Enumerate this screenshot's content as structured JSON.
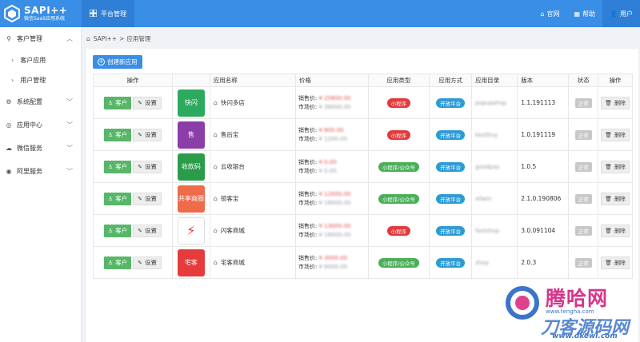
{
  "logo": {
    "title": "SAPI++",
    "subtitle": "微信SaaS应用系统"
  },
  "topbar": {
    "tab": "平台管理",
    "links": [
      "官网",
      "帮助",
      "用户"
    ]
  },
  "sidebar": {
    "items": [
      {
        "label": "客户管理",
        "children": [
          "客户应用",
          "用户管理"
        ]
      },
      {
        "label": "系统配置"
      },
      {
        "label": "应用中心"
      },
      {
        "label": "微信服务"
      },
      {
        "label": "阿里服务"
      }
    ]
  },
  "breadcrumb": {
    "root": "SAPI++",
    "sep": ">",
    "current": "应用管理"
  },
  "create_button": "创建新应用",
  "table": {
    "headers": [
      "操作",
      "",
      "应用名称",
      "价格",
      "应用类型",
      "应用方式",
      "应用目录",
      "版本",
      "状态",
      "操作"
    ],
    "btn_customer": "客户",
    "btn_settings": "设置",
    "btn_delete": "删除",
    "price_sale_label": "销售价:",
    "price_market_label": "市场价:",
    "rows": [
      {
        "name": "快闪多店",
        "icon": "快闪",
        "icon_color": "#2eaa60",
        "sale": "¥ 25800.00",
        "market": "¥ 38000.00",
        "type": "小程序",
        "type_style": "red",
        "mode": "开放平台",
        "dir": "popupshop",
        "version": "1.1.191113",
        "status": "正常"
      },
      {
        "name": "售后宝",
        "icon": "售",
        "icon_color": "#8b3da8",
        "sale": "¥ 800.00",
        "market": "¥ 1200.00",
        "type": "小程序",
        "type_style": "red",
        "mode": "开放平台",
        "dir": "bestbuy",
        "version": "1.0.191119",
        "status": "正常"
      },
      {
        "name": "云收银台",
        "icon": "收款码",
        "icon_color": "#2a9c4a",
        "sale": "¥ 0.00",
        "market": "¥ 0.00",
        "type": "小程序/公众号",
        "type_style": "green",
        "mode": "开放平台",
        "dir": "goodpay",
        "version": "1.0.5",
        "status": "正常"
      },
      {
        "name": "锁客宝",
        "icon": "共享商圈",
        "icon_color": "#ee6c4a",
        "sale": "¥ 12000.00",
        "market": "¥ 18000.00",
        "type": "小程序/公众号",
        "type_style": "green",
        "mode": "开放平台",
        "dir": "allwin",
        "version": "2.1.0.190806",
        "status": "正常"
      },
      {
        "name": "闪客商城",
        "icon": "⚡",
        "icon_color": "#ffffff",
        "sale": "¥ 13000.00",
        "market": "¥ 18000.00",
        "type": "小程序",
        "type_style": "red",
        "mode": "开放平台",
        "dir": "fastshop",
        "version": "3.0.091104",
        "status": "正常"
      },
      {
        "name": "宅客商城",
        "icon": "宅客",
        "icon_color": "#e53b3b",
        "sale": "¥ 3000.00",
        "market": "¥ 6000.00",
        "type": "小程序/公众号",
        "type_style": "green",
        "mode": "开放平台",
        "dir": "shop",
        "version": "2.0.3",
        "status": "正常"
      }
    ]
  },
  "watermark": {
    "line1": "腾哈网",
    "url1": "www.tengha.com",
    "line2": "刀客源码网",
    "url2": "www.dkewl.com"
  }
}
